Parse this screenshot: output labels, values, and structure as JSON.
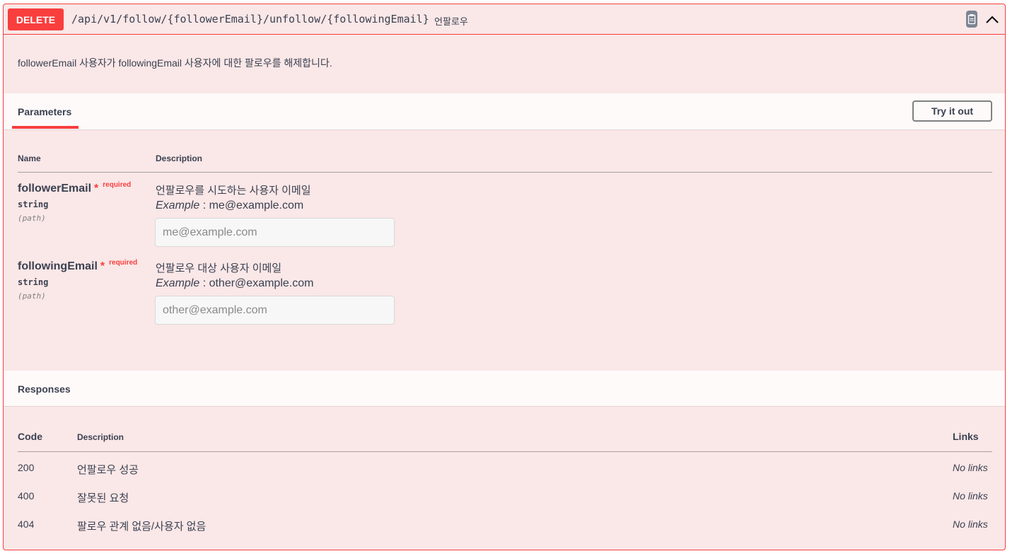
{
  "operation": {
    "method": "DELETE",
    "path": "/api/v1/follow/{followerEmail}/unfollow/{followingEmail}",
    "summary": "언팔로우",
    "description": "followerEmail 사용자가 followingEmail 사용자에 대한 팔로우를 해제합니다.",
    "copy_icon": "clipboard-icon",
    "collapse_icon": "chevron-up-icon"
  },
  "parameters": {
    "tab_label": "Parameters",
    "try_label": "Try it out",
    "col_name": "Name",
    "col_description": "Description",
    "items": [
      {
        "name": "followerEmail",
        "star": "*",
        "required": "required",
        "type": "string",
        "in": "(path)",
        "description": "언팔로우를 시도하는 사용자 이메일",
        "example_label": "Example",
        "example_value": " : me@example.com",
        "placeholder": "me@example.com"
      },
      {
        "name": "followingEmail",
        "star": "*",
        "required": "required",
        "type": "string",
        "in": "(path)",
        "description": "언팔로우 대상 사용자 이메일",
        "example_label": "Example",
        "example_value": " : other@example.com",
        "placeholder": "other@example.com"
      }
    ]
  },
  "responses": {
    "title": "Responses",
    "col_code": "Code",
    "col_description": "Description",
    "col_links": "Links",
    "items": [
      {
        "code": "200",
        "description": "언팔로우 성공",
        "links": "No links"
      },
      {
        "code": "400",
        "description": "잘못된 요청",
        "links": "No links"
      },
      {
        "code": "404",
        "description": "팔로우 관계 없음/사용자 없음",
        "links": "No links"
      }
    ]
  },
  "colors": {
    "delete_accent": "#f93e3e",
    "block_background": "#fae7e7",
    "text": "#3b4151"
  }
}
